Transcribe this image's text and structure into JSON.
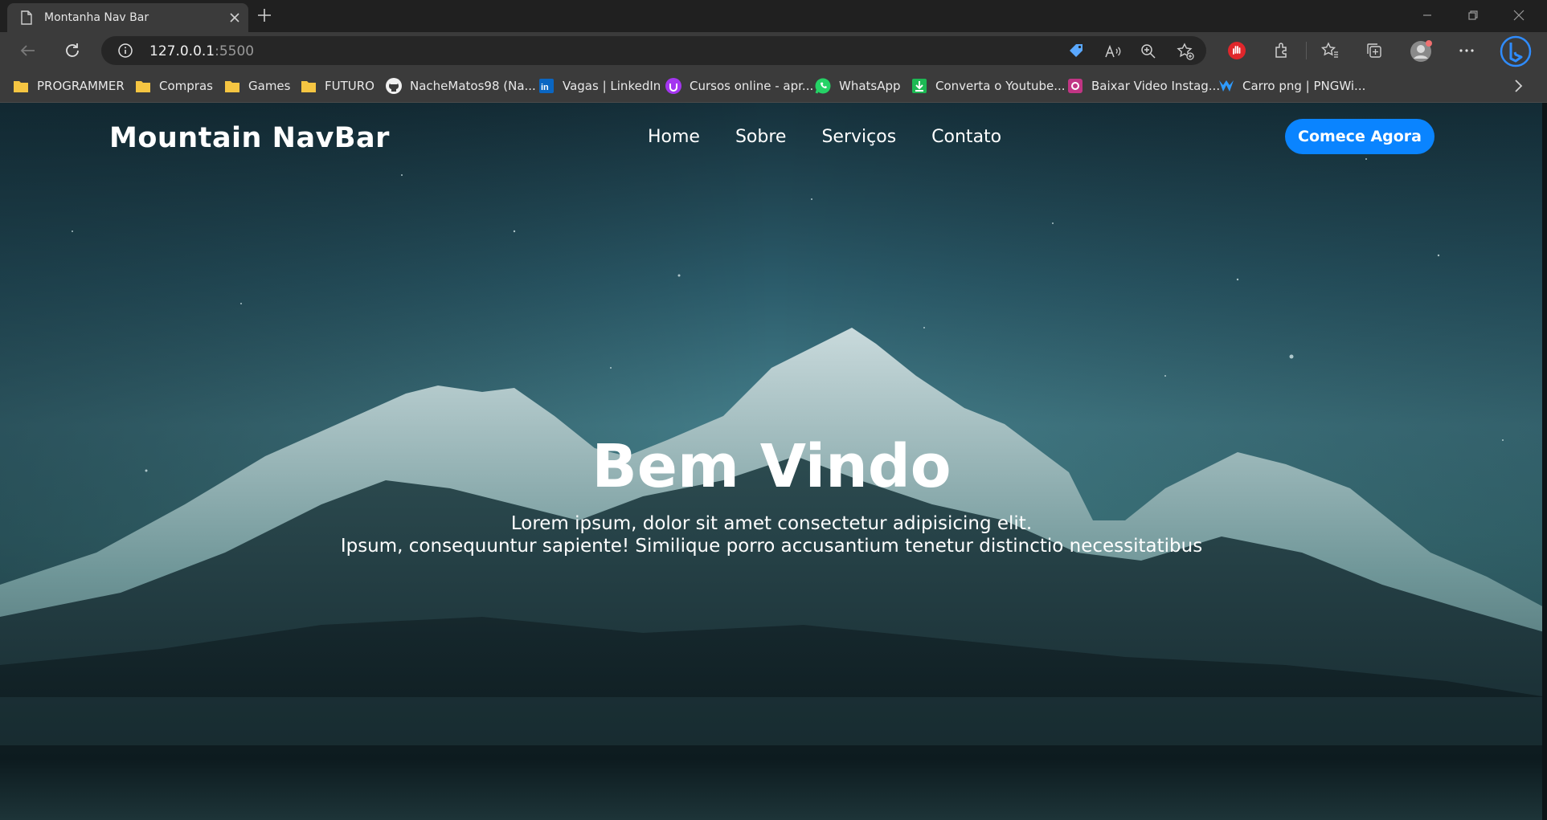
{
  "browser": {
    "tab_title": "Montanha Nav Bar",
    "url_host": "127.0.0.1",
    "url_port": ":5500",
    "bookmarks": [
      {
        "label": "PROGRAMMER",
        "icon": "folder-icon"
      },
      {
        "label": "Compras",
        "icon": "folder-icon"
      },
      {
        "label": "Games",
        "icon": "folder-icon"
      },
      {
        "label": "FUTURO",
        "icon": "folder-icon"
      },
      {
        "label": "NacheMatos98 (Na...",
        "icon": "github-icon"
      },
      {
        "label": "Vagas | LinkedIn",
        "icon": "linkedin-icon"
      },
      {
        "label": "Cursos online - apr...",
        "icon": "udemy-icon"
      },
      {
        "label": "WhatsApp",
        "icon": "whatsapp-icon"
      },
      {
        "label": "Converta o Youtube...",
        "icon": "download-icon"
      },
      {
        "label": "Baixar Video Instag...",
        "icon": "instagram-downloader-icon"
      },
      {
        "label": "Carro png | PNGWi...",
        "icon": "pngwing-icon"
      }
    ]
  },
  "page": {
    "brand": "Mountain NavBar",
    "nav": [
      "Home",
      "Sobre",
      "Serviços",
      "Contato"
    ],
    "cta": "Comece Agora",
    "hero_title": "Bem Vindo",
    "hero_line1": "Lorem ipsum, dolor sit amet consectetur adipisicing elit.",
    "hero_line2": "Ipsum, consequuntur sapiente! Similique porro accusantium tenetur distinctio necessitatibus"
  },
  "colors": {
    "cta_bg": "#0a84ff",
    "chrome_dark": "#202020",
    "chrome_light": "#3b3b3b"
  }
}
